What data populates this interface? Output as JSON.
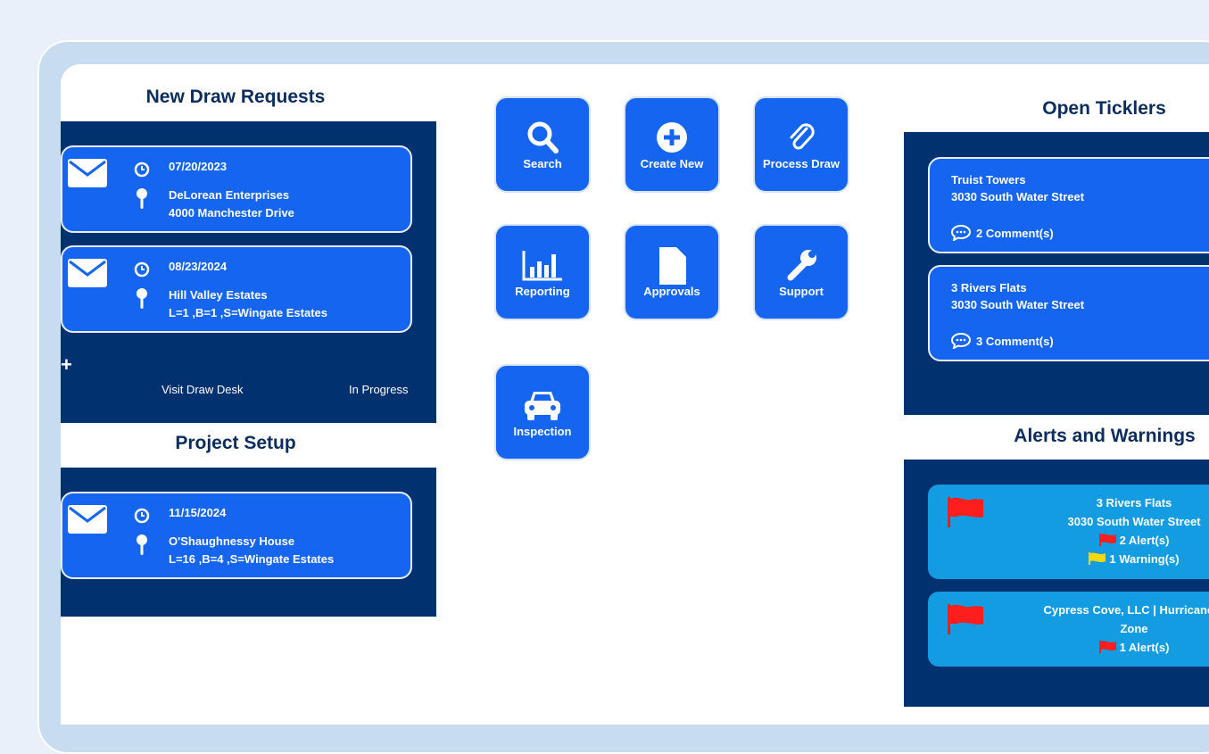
{
  "draw_requests": {
    "title": "New Draw Requests",
    "cards": [
      {
        "date": "07/20/2023",
        "name": "DeLorean Enterprises",
        "address": "4000 Manchester Drive"
      },
      {
        "date": "08/23/2024",
        "name": "Hill Valley Estates",
        "address": "L=1 ,B=1 ,S=Wingate Estates"
      }
    ],
    "add_label": "+",
    "visit_label": "Visit Draw Desk",
    "status_label": "In Progress"
  },
  "project_setup": {
    "title": "Project Setup",
    "cards": [
      {
        "date": "11/15/2024",
        "name": "O'Shaughnessy House",
        "address": "L=16 ,B=4 ,S=Wingate Estates"
      }
    ]
  },
  "tiles": [
    {
      "label": "Search",
      "icon": "search-icon"
    },
    {
      "label": "Create New",
      "icon": "plus-circle-icon"
    },
    {
      "label": "Process Draw",
      "icon": "paperclip-icon"
    },
    {
      "label": "Reporting",
      "icon": "bar-chart-icon"
    },
    {
      "label": "Approvals",
      "icon": "document-icon"
    },
    {
      "label": "Support",
      "icon": "wrench-icon"
    },
    {
      "label": "Inspection",
      "icon": "car-icon"
    }
  ],
  "ticklers": {
    "title": "Open Ticklers",
    "items": [
      {
        "name": "Truist Towers",
        "address": "3030 South Water Street",
        "comments": "2 Comment(s)"
      },
      {
        "name": "3 Rivers Flats",
        "address": "3030 South Water Street",
        "comments": "3 Comment(s)"
      }
    ]
  },
  "alerts": {
    "title": "Alerts and Warnings",
    "items": [
      {
        "name": "3 Rivers Flats",
        "address": "3030 South Water Street",
        "alerts": "2 Alert(s)",
        "warnings": "1 Warning(s)"
      },
      {
        "name": "Cypress Cove, LLC | Hurricane V",
        "address": "Zone",
        "alerts": "1 Alert(s)"
      }
    ]
  },
  "colors": {
    "panel": "#02316f",
    "card": "#1565f0",
    "alert_card": "#139ce2",
    "title": "#0d2c5e",
    "flag_red": "#ff1e1e",
    "flag_yellow": "#f5d90a"
  }
}
